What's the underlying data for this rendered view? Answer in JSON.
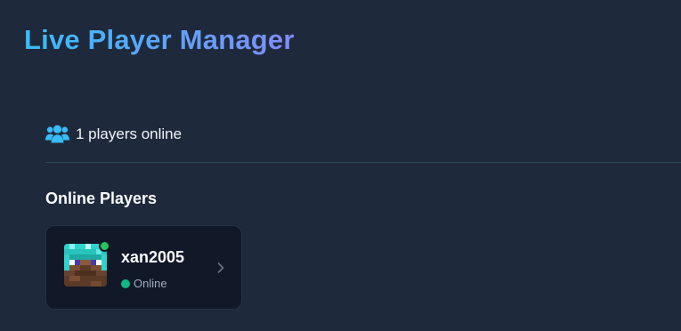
{
  "header": {
    "title": "Live Player Manager"
  },
  "summary": {
    "icon": "users-icon",
    "count_text": "1 players online"
  },
  "section": {
    "title": "Online Players"
  },
  "players": [
    {
      "name": "xan2005",
      "status": "Online",
      "avatar_icon": "player-skin-head",
      "status_color": "#10b981"
    }
  ],
  "colors": {
    "background": "#1e293b",
    "title_gradient_start": "#38bdf8",
    "title_gradient_end": "#818cf8",
    "accent": "#38bdf8",
    "card_background": "#111827",
    "online": "#22c55e"
  }
}
